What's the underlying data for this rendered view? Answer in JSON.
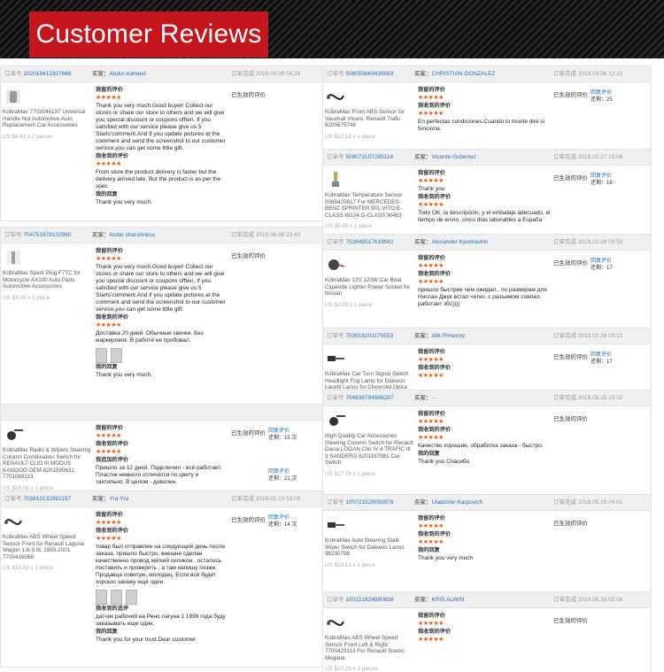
{
  "header": {
    "title": "Customer Reviews"
  },
  "labels": {
    "order_prefix": "订单号",
    "buyer_prefix": "买家：",
    "completed_prefix": "订单完成",
    "status_given": "已生效的评价",
    "buyer_review": "我留的评价",
    "seller_reply": "我收到的评价",
    "my_reply": "我的回复",
    "followup": "我追加的评价",
    "reply_action": "回复评价",
    "reply_count_prefix": "还剩："
  },
  "colors": {
    "title_bg": "#c4161c",
    "link": "#1d6fbf",
    "star": "#f25a0a"
  },
  "left": [
    {
      "order": "102018413307666",
      "buyer": "Abdul waheed",
      "date": "2019.06.09 09:28",
      "product": "KobraMax 7703044197 Universal Handle Nut Automotive Auto Replacement Car Accessories",
      "price": "US $4.41 x 2 pieces",
      "img": "nut",
      "blocks": [
        {
          "label": "我留的评价",
          "stars": "★★★★★",
          "text": "Thank you very much.Good buyer! Collect our stores or share our store to others and we will give you special discount or coupons offten. If you satisfied with our service please give us 5 Starts'comment.And If you update pictures at the comment and send the screenshot to our customer service,you can get some little gift."
        },
        {
          "label": "我收到的评价",
          "stars": "★★★★★",
          "text": "From store the product delivery is faster but the delivery arrived late. But the product is as per the spec"
        },
        {
          "label": "我的回复",
          "text": "Thank you very much."
        }
      ],
      "status": "已生效的评价"
    },
    {
      "order": "704751978102960",
      "buyer": "Ilodar sharshnkou",
      "date": "2019.06.08 23:43",
      "product": "KobraMax Spark Plug F7TC for Motorcycle AX100 Auto Parts Automotive Accessories",
      "price": "US $3.05 x 1 piece",
      "img": "plug",
      "blocks": [
        {
          "label": "我留的评价",
          "stars": "★★★★★",
          "text": "Thank you very much.Good buyer! Collect our stores or share our store to others and we will give you special discount or coupons offten. If you satisfied with our service please give us 5 Starts'comment.And If you update pictures at the comment and send the screenshot to our customer service,you can get some little gift."
        },
        {
          "label": "我收到的评价",
          "stars": "★★★★★",
          "text": "Доставка 20 дней. Обычные свечки. Без маркировок. В работе не пробовал.",
          "photos": 2
        },
        {
          "label": "我的回复",
          "text": "Thank you very much."
        }
      ],
      "status": "已生效的评价"
    },
    {
      "order": "",
      "buyer": "",
      "date": "",
      "product": "KobraMax Radio & Wipers Steering Column Combination Switch for RENAULT CLIO III MODUS KANGOO OEM-8201590631 7701068113",
      "price": "US $20.09 x 1 piece",
      "img": "switch",
      "blocks": [
        {
          "label": "我留的评价",
          "stars": "★★★★★",
          "text": ""
        },
        {
          "label": "我收到的评价",
          "stars": "★★★★★",
          "text": ""
        },
        {
          "label": "我追加的评价",
          "text": "Пришло за 12 дней. Подключил - всё работает. Пластик немного отличатся по цвету и тактильно. В целом - доволен."
        }
      ],
      "status": "已生效的评价",
      "reply_action": "回复评价",
      "reply_count": "15 次",
      "reply_action2": "回复评价",
      "reply_count2": "21 次"
    },
    {
      "order": "703813132981197",
      "buyer": "Yra Yra",
      "date": "2019.02.23 03:00",
      "product": "KobraMax ABS Wheel Speed Sensor Front for Renault Laguna Wagon 1.6-3.0L 1993-2001 7700416066",
      "price": "US $10.59 x 1 piece",
      "img": "sensor",
      "blocks": [
        {
          "label": "我留的评价",
          "stars": "★★★★★",
          "text": ""
        },
        {
          "label": "我收到的评价",
          "stars": "★★★★★",
          "text": "товар был отправлен на следующий день после заказа, пришло быстро. внешне сделан качественно провод мягкий силикон , осталось поставить и проверить , а там напишу позже. Продавца советую, молодец. Если всё будет хорошо закажу ещё один.",
          "photos": 3
        },
        {
          "label": "我收到的追评",
          "text": "датчик рабочий на Рено лагуна 1 1999 года буду заказывать еще один."
        },
        {
          "label": "我的回复",
          "text": "Thank you for your trust.Dear customer"
        }
      ],
      "status": "已生效的评价",
      "reply_action": "回复评价",
      "reply_count": "14 次"
    }
  ],
  "right": [
    {
      "order": "508055669439083",
      "buyer": "CHRISTIAN GONZALEZ",
      "date": "2019.03.06 12:10",
      "product": "KobraMax Front ABS Sensor for Vauxhall Vivaro, Renault Trafic 8200675748",
      "price": "US $12.19 x 1 piece",
      "img": "sensor",
      "blocks": [
        {
          "label": "我留的评价",
          "stars": "★★★★★",
          "text": ""
        },
        {
          "label": "我收到的评价",
          "stars": "★★★★★",
          "text": "En perfectas condiciones.Cuando lo monte diré si funciona."
        }
      ],
      "status": "已生效的评价",
      "reply_action": "回复评价",
      "reply_count": "25"
    },
    {
      "order": "508073107295114",
      "buyer": "Vicente Gutierrez",
      "date": "2019.02.27 15:08",
      "product": "KobraMax Temperature Sensor 0085425617 For MERCEDES-BENZ SPRINTER 901,VITO,E-CLASS W124,G-CLASS W463",
      "price": "US $5.99 x 1 piece",
      "img": "temp",
      "blocks": [
        {
          "label": "我留的评价",
          "stars": "★★★★★",
          "text": "Thank you"
        },
        {
          "label": "我收到的评价",
          "stars": "★★★★★",
          "text": "Todo OK, la descripción, y el embalaje adecuado, el tiempo de envío, cinco días laborables a España"
        }
      ],
      "status": "已生效的评价",
      "reply_action": "回复评价",
      "reply_count": "18"
    },
    {
      "order": "703848517619942",
      "buyer": "Alexander Kandrashin",
      "date": "2019.02.26 03:59",
      "product": "KobraMax 12V 120W Car Boat Cigarette Lighter Power Socket for Nissan",
      "price": "US $3.89 x 1 piece",
      "img": "socket",
      "blocks": [
        {
          "label": "我留的评价",
          "stars": "★★★★★",
          "text": ""
        },
        {
          "label": "我收到的评价",
          "stars": "★★★★★",
          "text": "пришло быстрее чем ожидал.. по размерам для Ниссан Джук встал четко. с разъемом совпал. работает збс))))"
        }
      ],
      "status": "已生效的评价",
      "reply_action": "回复评价",
      "reply_count": "17"
    },
    {
      "order": "703918201170553",
      "buyer": "Alik Pimenov",
      "date": "2019.02.26 03:11",
      "product": "KobraMax Car Turn Signal Switch Headlight Fog Lamp for Daewoo Lacetti Lanos for Chevrolet Optra 96387324",
      "price": "",
      "img": "stalk",
      "blocks": [
        {
          "label": "我留的评价",
          "stars": "★★★★★",
          "text": ""
        },
        {
          "label": "我收到的评价",
          "stars": "★★★★★",
          "text": ""
        }
      ],
      "status": "已生效的评价",
      "reply_action": "回复评价",
      "reply_count": "17"
    },
    {
      "order": "704638794948287",
      "buyer": "- -",
      "date": "2019.05.18 23:32",
      "product": "High Quality Car Accessories Steering Column Switch for Renault Dacia LOGAN Clio IV 4 TRAFIC III 3 SANDERO 8201167981 Car Switch",
      "price": "US $17.79 x 1 piece",
      "img": "switch",
      "blocks": [
        {
          "label": "我留的评价",
          "stars": "★★★★★",
          "text": ""
        },
        {
          "label": "我收到的评价",
          "stars": "★★★★★",
          "text": "Качество хорошие, обработка заказа - быстро."
        },
        {
          "label": "我的回复",
          "text": "Thank you Спасибо"
        }
      ],
      "status": "已生效的评价"
    },
    {
      "order": "100721529093976",
      "buyer": "Uladzimir Karpovich",
      "date": "2019.05.18 04:01",
      "product": "KobraMax Auto Steering Stalk Wiper Switch for Daewoo Lanos 96230798",
      "price": "US $10.13 x 1 piece",
      "img": "stalk",
      "blocks": [
        {
          "label": "我留的评价",
          "stars": "★★★★★",
          "text": ""
        },
        {
          "label": "我收到的评价",
          "stars": "★★★★★",
          "text": ""
        },
        {
          "label": "我的回复",
          "text": "Thank you very much"
        }
      ],
      "status": "已生效的评价"
    },
    {
      "order": "100121824880658",
      "buyer": "KRIS ALWIN",
      "date": "2019.05.18 02:08",
      "product": "KobraMax ABS Wheel Speed Sensor Front Left & Right 7700429113 For Renault Scenic Megane",
      "price": "US $10.29 x 2 pieces",
      "img": "sensor",
      "blocks": [
        {
          "label": "我留的评价",
          "stars": "★★★★★",
          "text": ""
        },
        {
          "label": "我收到的评价",
          "stars": "★★★★★",
          "text": ""
        }
      ],
      "status": "已生效的评价"
    }
  ]
}
